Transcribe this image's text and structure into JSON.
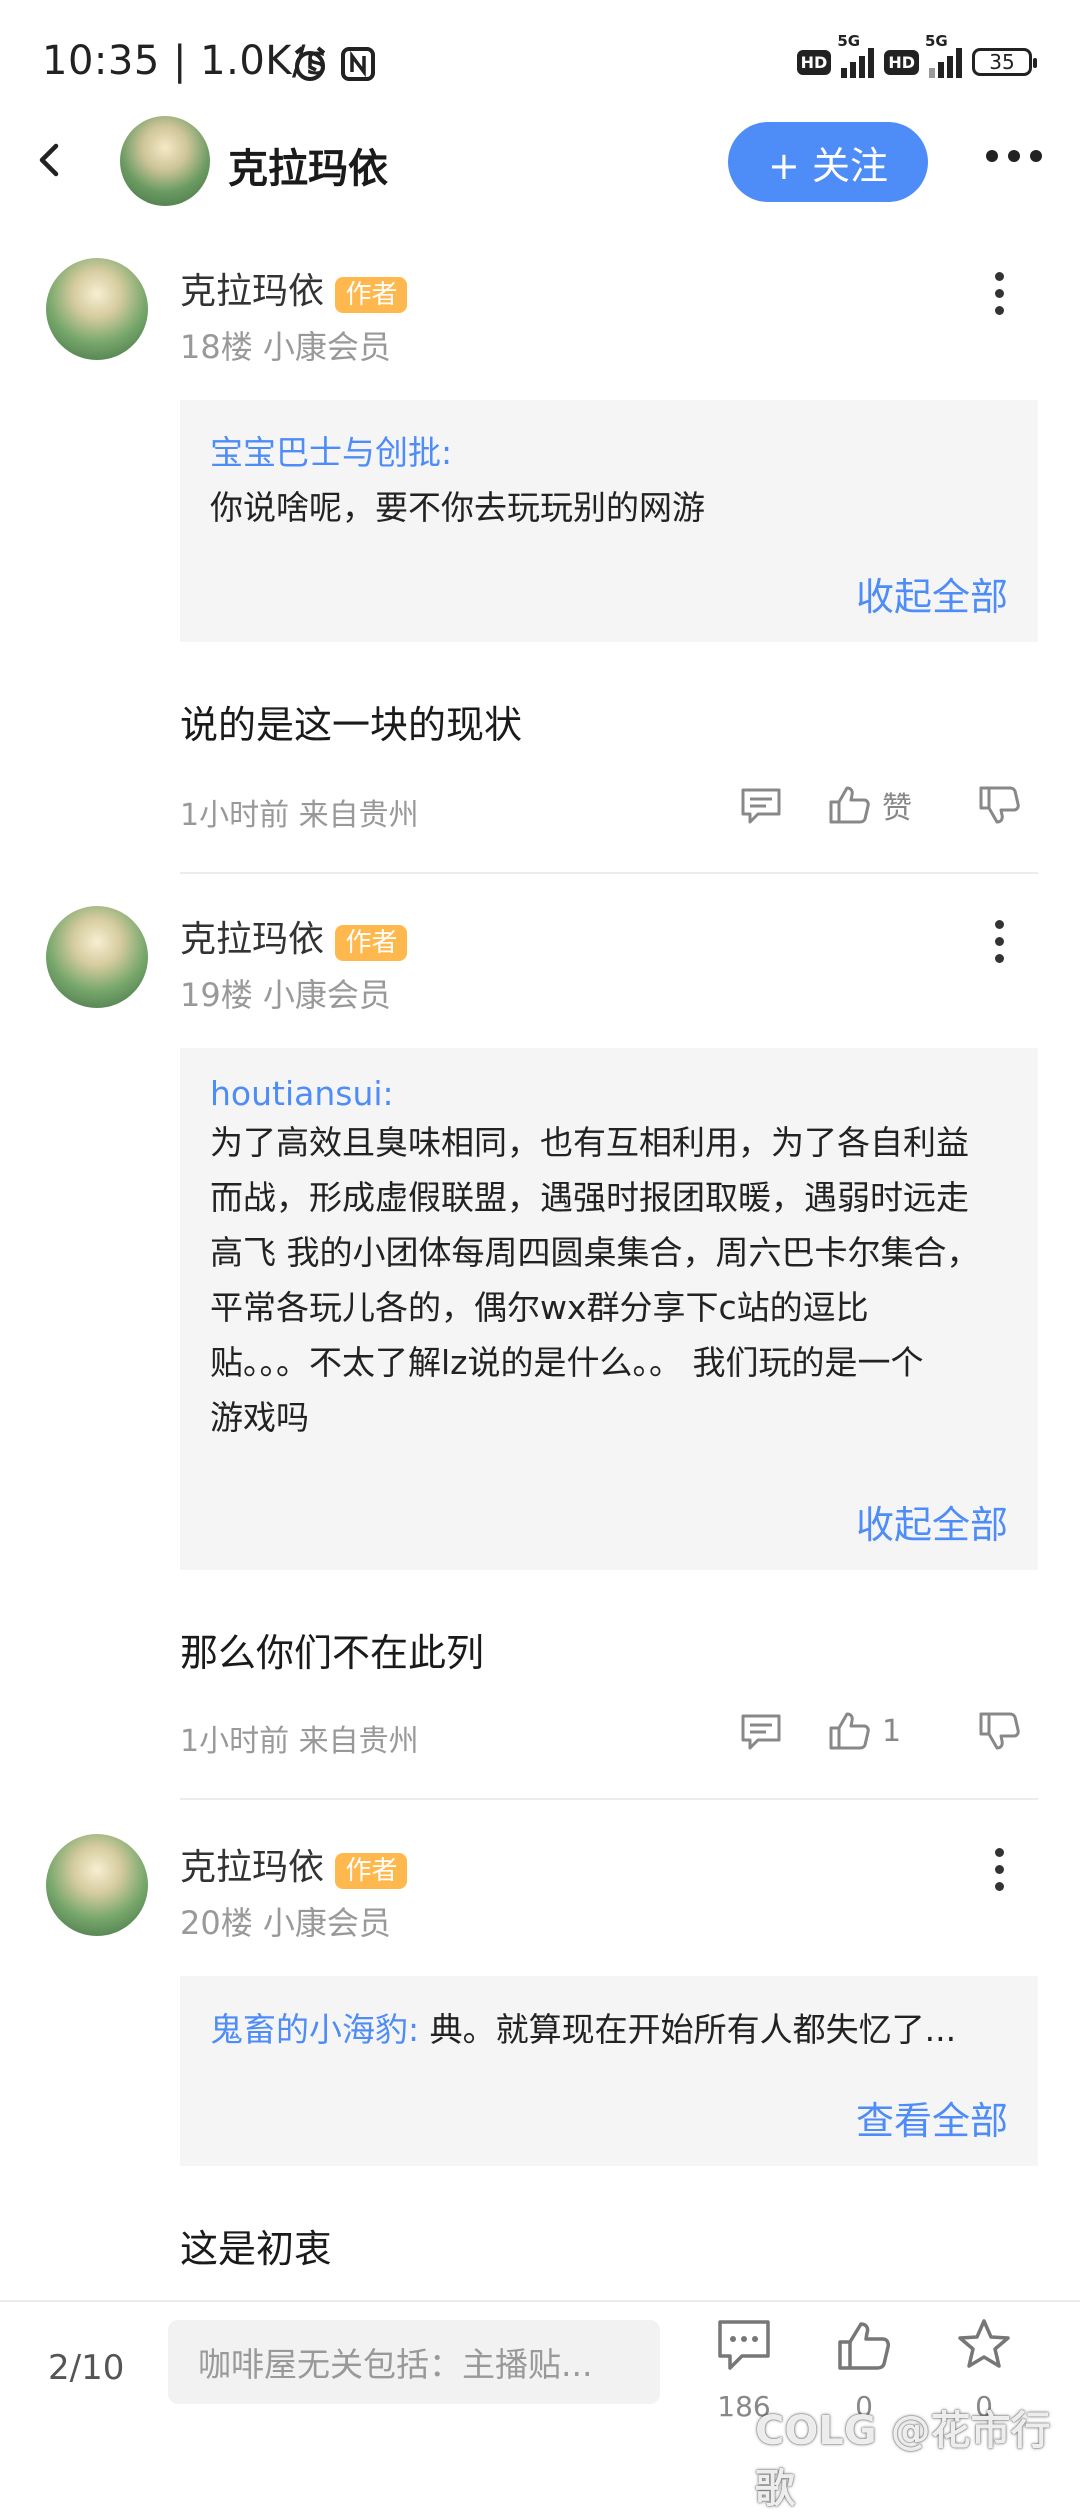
{
  "status_bar": {
    "time": "10:35 | 1.0K/s",
    "hd": "HD",
    "net1": "5G",
    "net2": "5G",
    "battery": "35"
  },
  "header": {
    "title": "克拉玛依",
    "follow_label": "+ 关注"
  },
  "posts": [
    {
      "author": "克拉玛依",
      "badge": "作者",
      "floor_meta": "18楼  小康会员",
      "quote_author": "宝宝巴士与创批:",
      "quote_text": "你说啥呢，要不你去玩玩别的网游",
      "quote_toggle": "收起全部",
      "text": "说的是这一块的现状",
      "time_location": "1小时前 来自贵州",
      "like_label": "赞"
    },
    {
      "author": "克拉玛依",
      "badge": "作者",
      "floor_meta": "19楼  小康会员",
      "quote_author": "houtiansui:",
      "quote_lines": [
        "为了高效且臭味相同，也有互相利用，为了各自利益",
        "而战，形成虚假联盟，遇强时报团取暖，遇弱时远走",
        "高飞 我的小团体每周四圆桌集合，周六巴卡尔集合，",
        "平常各玩儿各的，偶尔wx群分享下c站的逗比",
        "贴。。。不太了解lz说的是什么。。 我们玩的是一个",
        "游戏吗"
      ],
      "quote_toggle": "收起全部",
      "text": "那么你们不在此列",
      "time_location": "1小时前 来自贵州",
      "like_label": "1"
    },
    {
      "author": "克拉玛依",
      "badge": "作者",
      "floor_meta": "20楼  小康会员",
      "quote_author": "鬼畜的小海豹:",
      "quote_text": "典。就算现在开始所有人都失忆了...",
      "quote_toggle": "查看全部",
      "text": "这是初衷"
    }
  ],
  "bottom_bar": {
    "page": "2/10",
    "input_placeholder": "咖啡屋无关包括：主播贴...",
    "comments_count": "186",
    "likes_count": "0",
    "favorites_count": "0"
  },
  "watermark": "COLG @花市行歌",
  "colors": {
    "accent": "#4e8cf7",
    "badge": "#ffb84d"
  },
  "icons": [
    "back-arrow-icon",
    "more-icon",
    "kebab-icon",
    "comment-icon",
    "thumb-up-icon",
    "thumb-down-icon",
    "star-icon"
  ]
}
